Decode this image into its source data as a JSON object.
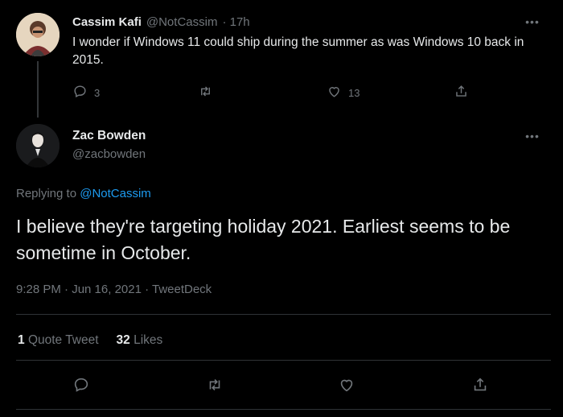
{
  "parent_tweet": {
    "display_name": "Cassim Kafi",
    "handle": "@NotCassim",
    "time": "· 17h",
    "text": "I wonder if Windows 11 could ship during the summer as was Windows 10 back in 2015.",
    "replies": "3",
    "retweets": "",
    "likes": "13"
  },
  "main_tweet": {
    "display_name": "Zac Bowden",
    "handle": "@zacbowden",
    "replying_prefix": "Replying to",
    "replying_to": "@NotCassim",
    "text": "I believe they're targeting holiday 2021. Earliest seems to be sometime in October.",
    "timestamp": "9:28 PM · Jun 16, 2021 · TweetDeck",
    "quote_count": "1",
    "quote_label": "Quote Tweet",
    "like_count": "32",
    "like_label": "Likes"
  },
  "icons": {
    "reply": "reply-icon",
    "retweet": "retweet-icon",
    "like": "heart-icon",
    "share": "share-icon",
    "more": "more-icon"
  },
  "colors": {
    "background": "#000000",
    "text": "#e7e9ea",
    "muted": "#71767b",
    "link": "#1d9bf0",
    "divider": "#2f3336"
  }
}
